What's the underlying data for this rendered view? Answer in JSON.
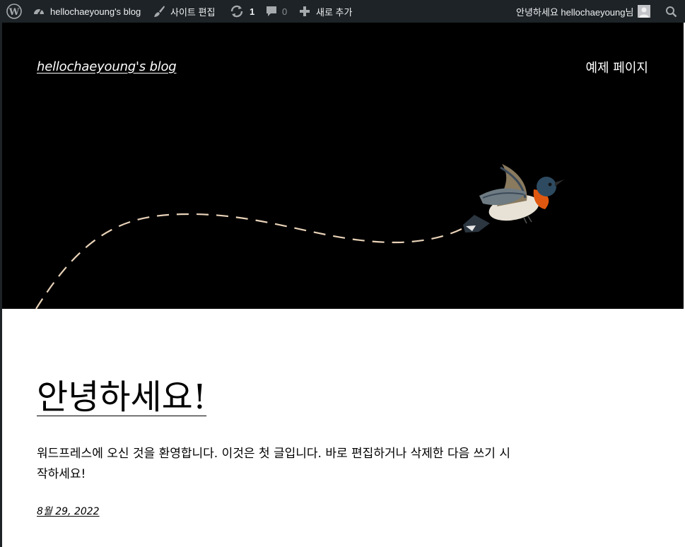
{
  "admin_bar": {
    "site_name": "hellochaeyoung's blog",
    "edit_site": "사이트 편집",
    "updates_count": "1",
    "comments_count": "0",
    "new_content": "새로 추가",
    "greeting": "안녕하세요 hellochaeyoung님",
    "icons": [
      "wordpress-logo-icon",
      "dashboard-icon",
      "brush-icon",
      "updates-icon",
      "comment-icon",
      "plus-icon",
      "avatar",
      "search-icon"
    ]
  },
  "header": {
    "site_title": "hellochaeyoung's blog",
    "nav_link": "예제 페이지"
  },
  "post": {
    "title": "안녕하세요!",
    "excerpt": "워드프레스에 오신 것을 환영합니다. 이것은 첫 글입니다. 바로 편집하거나 삭제한 다음 쓰기 시작하세요!",
    "date": "8월 29, 2022"
  },
  "colors": {
    "admin_bar_bg": "#1d2327",
    "hero_bg": "#000000",
    "dashed_path": "#e8d2b8"
  }
}
